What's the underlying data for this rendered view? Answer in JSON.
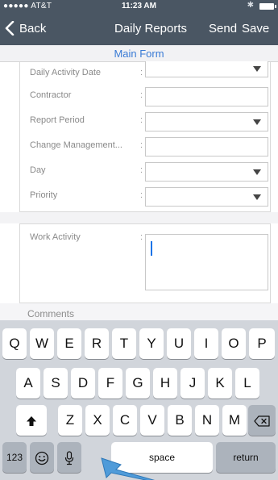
{
  "status_bar": {
    "carrier": "●●●●● AT&T",
    "time": "11:23 AM"
  },
  "nav": {
    "back_label": "Back",
    "title": "Daily Reports",
    "send_label": "Send",
    "save_label": "Save"
  },
  "form": {
    "header": "Main Form",
    "rows": [
      {
        "label": "Daily Activity Date",
        "type": "dropdown",
        "value": ""
      },
      {
        "label": "Contractor",
        "type": "text",
        "value": ""
      },
      {
        "label": "Report Period",
        "type": "dropdown",
        "value": ""
      },
      {
        "label": "Change Management...",
        "type": "text",
        "value": ""
      },
      {
        "label": "Day",
        "type": "dropdown",
        "value": ""
      },
      {
        "label": "Priority",
        "type": "dropdown",
        "value": ""
      }
    ],
    "work_activity": {
      "label": "Work Activity",
      "value": ""
    },
    "comments_label": "Comments",
    "colon": ":"
  },
  "keyboard": {
    "row1": [
      "Q",
      "W",
      "E",
      "R",
      "T",
      "Y",
      "U",
      "I",
      "O",
      "P"
    ],
    "row2": [
      "A",
      "S",
      "D",
      "F",
      "G",
      "H",
      "J",
      "K",
      "L"
    ],
    "row3": [
      "Z",
      "X",
      "C",
      "V",
      "B",
      "N",
      "M"
    ],
    "numbers_label": "123",
    "space_label": "space",
    "return_label": "return",
    "icons": {
      "shift": "shift-icon",
      "delete": "delete-icon",
      "emoji": "emoji-icon",
      "mic": "microphone-icon"
    }
  },
  "colors": {
    "nav_bg": "#4a5663",
    "accent": "#3a7bd5",
    "keyboard_bg": "#d1d5db",
    "cursor": "#1a73e8"
  }
}
